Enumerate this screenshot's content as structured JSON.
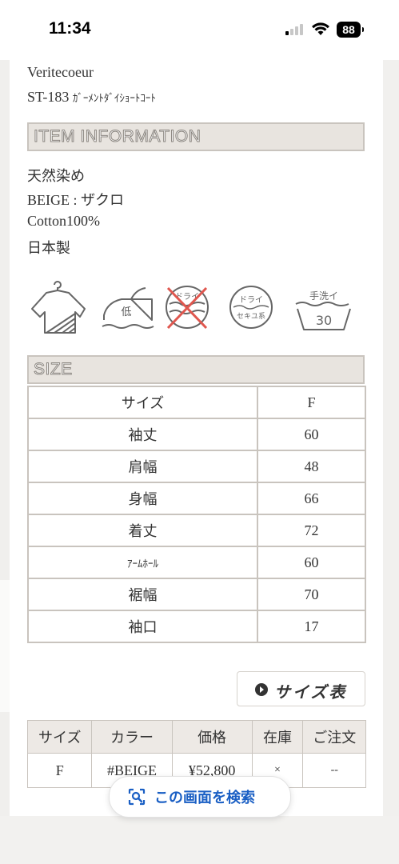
{
  "status_bar": {
    "time": "11:34",
    "battery": "88"
  },
  "product": {
    "brand": "Veritecoeur",
    "code": "ST-183 ",
    "name_kana": "ｶﾞｰﾒﾝﾄﾀﾞｲｼｮｰﾄｺｰﾄ"
  },
  "item_info": {
    "header": "ITEM INFORMATION",
    "lines": [
      "天然染め",
      "BEIGE : ザクロ",
      "Cotton100%",
      "日本製"
    ]
  },
  "care_icons": [
    "hanging-dry-shade-icon",
    "iron-low-icon",
    "no-dry-clean-icon",
    "dry-clean-petroleum-icon",
    "hand-wash-30-icon"
  ],
  "care_labels": {
    "iron": "低",
    "no_dry": "ドライ",
    "dry_top": "ドライ",
    "dry_bottom": "セキユ系",
    "wash_top": "手洗イ",
    "wash_temp": "30"
  },
  "size": {
    "header": "SIZE",
    "rows": [
      {
        "label": "サイズ",
        "value": "F"
      },
      {
        "label": "袖丈",
        "value": "60"
      },
      {
        "label": "肩幅",
        "value": "48"
      },
      {
        "label": "身幅",
        "value": "66"
      },
      {
        "label": "着丈",
        "value": "72"
      },
      {
        "label": "ｱｰﾑﾎｰﾙ",
        "value": "60"
      },
      {
        "label": "裾幅",
        "value": "70"
      },
      {
        "label": "袖口",
        "value": "17"
      }
    ]
  },
  "size_chart_button": "サイズ表",
  "order_table": {
    "headers": [
      "サイズ",
      "カラー",
      "価格",
      "在庫",
      "ご注文"
    ],
    "row": [
      "F",
      "#BEIGE",
      "¥52,800",
      "×",
      "--"
    ]
  },
  "search_pill": {
    "label": "この画面を検索"
  },
  "colors": {
    "header_bg": "#e8e4df",
    "border": "#c9c4be",
    "search_text": "#1a5fc4"
  }
}
